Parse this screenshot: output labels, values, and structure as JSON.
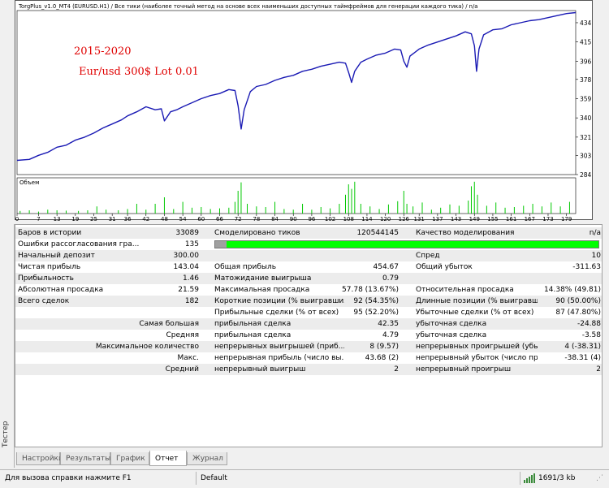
{
  "chart": {
    "header": "TorgPlus_v1.0_MT4 (EURUSD.H1) / Все тики (наиболее точный метод на основе всех наименьших доступных таймфреймов для генерации каждого тика) / n/a",
    "annotation_line1": "2015-2020",
    "annotation_line2": "Eur/usd 300$ Lot 0.01",
    "volume_label": "Объем",
    "line_color": "#1a1ab4",
    "volume_color": "#00c800",
    "annotation_color": "#e00000"
  },
  "chart_data": {
    "type": "line",
    "title": "",
    "ylim": [
      284,
      446
    ],
    "y_ticks": [
      "434",
      "415",
      "396",
      "378",
      "359",
      "340",
      "321",
      "303",
      "284"
    ],
    "x_ticks": [
      "0",
      "7",
      "13",
      "19",
      "25",
      "31",
      "36",
      "42",
      "48",
      "54",
      "60",
      "66",
      "72",
      "78",
      "84",
      "90",
      "96",
      "102",
      "108",
      "114",
      "120",
      "126",
      "131",
      "137",
      "143",
      "149",
      "155",
      "161",
      "167",
      "173",
      "179"
    ],
    "series": [
      {
        "values": [
          [
            0,
            298
          ],
          [
            4,
            299
          ],
          [
            7,
            303
          ],
          [
            10,
            306
          ],
          [
            13,
            311
          ],
          [
            16,
            313
          ],
          [
            19,
            318
          ],
          [
            22,
            321
          ],
          [
            25,
            325
          ],
          [
            28,
            330
          ],
          [
            31,
            334
          ],
          [
            34,
            338
          ],
          [
            36,
            342
          ],
          [
            39,
            346
          ],
          [
            42,
            351
          ],
          [
            45,
            348
          ],
          [
            47,
            349
          ],
          [
            48,
            337
          ],
          [
            50,
            346
          ],
          [
            52,
            348
          ],
          [
            54,
            351
          ],
          [
            57,
            355
          ],
          [
            60,
            359
          ],
          [
            63,
            362
          ],
          [
            66,
            364
          ],
          [
            69,
            368
          ],
          [
            71,
            367
          ],
          [
            72,
            352
          ],
          [
            73,
            329
          ],
          [
            74,
            348
          ],
          [
            76,
            366
          ],
          [
            78,
            371
          ],
          [
            81,
            373
          ],
          [
            84,
            377
          ],
          [
            87,
            380
          ],
          [
            90,
            382
          ],
          [
            93,
            386
          ],
          [
            96,
            388
          ],
          [
            99,
            391
          ],
          [
            102,
            393
          ],
          [
            105,
            395
          ],
          [
            107,
            394
          ],
          [
            108,
            385
          ],
          [
            109,
            375
          ],
          [
            110,
            386
          ],
          [
            112,
            395
          ],
          [
            114,
            398
          ],
          [
            117,
            402
          ],
          [
            120,
            404
          ],
          [
            123,
            408
          ],
          [
            125,
            407
          ],
          [
            126,
            396
          ],
          [
            127,
            390
          ],
          [
            128,
            401
          ],
          [
            131,
            408
          ],
          [
            134,
            412
          ],
          [
            137,
            415
          ],
          [
            140,
            418
          ],
          [
            143,
            421
          ],
          [
            146,
            425
          ],
          [
            148,
            423
          ],
          [
            149,
            411
          ],
          [
            149.7,
            386
          ],
          [
            150.5,
            408
          ],
          [
            152,
            422
          ],
          [
            155,
            427
          ],
          [
            158,
            428
          ],
          [
            161,
            432
          ],
          [
            164,
            434
          ],
          [
            167,
            436
          ],
          [
            170,
            437
          ],
          [
            173,
            439
          ],
          [
            176,
            441
          ],
          [
            179,
            443
          ],
          [
            182,
            444
          ]
        ]
      }
    ],
    "volume_spikes": [
      [
        1,
        0.08
      ],
      [
        4,
        0.1
      ],
      [
        7,
        0.06
      ],
      [
        10,
        0.12
      ],
      [
        13,
        0.1
      ],
      [
        16,
        0.09
      ],
      [
        20,
        0.08
      ],
      [
        23,
        0.1
      ],
      [
        26,
        0.22
      ],
      [
        29,
        0.12
      ],
      [
        33,
        0.1
      ],
      [
        36,
        0.14
      ],
      [
        39,
        0.3
      ],
      [
        42,
        0.12
      ],
      [
        45,
        0.3
      ],
      [
        48,
        0.5
      ],
      [
        51,
        0.14
      ],
      [
        54,
        0.36
      ],
      [
        57,
        0.18
      ],
      [
        60,
        0.2
      ],
      [
        63,
        0.14
      ],
      [
        66,
        0.16
      ],
      [
        69,
        0.18
      ],
      [
        71,
        0.36
      ],
      [
        72,
        0.7
      ],
      [
        73,
        0.96
      ],
      [
        75,
        0.3
      ],
      [
        78,
        0.22
      ],
      [
        81,
        0.2
      ],
      [
        84,
        0.36
      ],
      [
        87,
        0.14
      ],
      [
        90,
        0.12
      ],
      [
        93,
        0.3
      ],
      [
        96,
        0.12
      ],
      [
        99,
        0.2
      ],
      [
        102,
        0.16
      ],
      [
        105,
        0.3
      ],
      [
        107,
        0.58
      ],
      [
        108,
        0.9
      ],
      [
        109,
        0.76
      ],
      [
        110,
        0.98
      ],
      [
        112,
        0.3
      ],
      [
        115,
        0.22
      ],
      [
        118,
        0.14
      ],
      [
        121,
        0.28
      ],
      [
        124,
        0.38
      ],
      [
        126,
        0.7
      ],
      [
        127,
        0.3
      ],
      [
        129,
        0.22
      ],
      [
        132,
        0.34
      ],
      [
        135,
        0.12
      ],
      [
        138,
        0.18
      ],
      [
        141,
        0.28
      ],
      [
        144,
        0.24
      ],
      [
        147,
        0.4
      ],
      [
        148,
        0.84
      ],
      [
        149,
        0.98
      ],
      [
        150,
        0.58
      ],
      [
        153,
        0.24
      ],
      [
        156,
        0.34
      ],
      [
        159,
        0.18
      ],
      [
        162,
        0.2
      ],
      [
        165,
        0.24
      ],
      [
        168,
        0.3
      ],
      [
        171,
        0.22
      ],
      [
        174,
        0.34
      ],
      [
        177,
        0.22
      ],
      [
        180,
        0.36
      ]
    ]
  },
  "report": {
    "rows": [
      {
        "a_label": "Баров в истории",
        "a_val": "33089",
        "b_label": "Смоделировано тиков",
        "b_val": "120544145",
        "c_label": "Качество моделирования",
        "c_val": "n/a"
      },
      {
        "a_label": "Ошибки рассогласования гра...",
        "a_val": "135",
        "quality_bar_color": "#00ff00"
      },
      {
        "a_label": "Начальный депозит",
        "a_val": "300.00",
        "c_label": "Спред",
        "c_val": "10"
      },
      {
        "a_label": "Чистая прибыль",
        "a_val": "143.04",
        "b_label": "Общая прибыль",
        "b_val": "454.67",
        "c_label": "Общий убыток",
        "c_val": "-311.63"
      },
      {
        "a_label": "Прибыльность",
        "a_val": "1.46",
        "b_label": "Матожидание выигрыша",
        "b_val": "0.79"
      },
      {
        "a_label": "Абсолютная просадка",
        "a_val": "21.59",
        "b_label": "Максимальная просадка",
        "b_val": "57.78 (13.67%)",
        "c_label": "Относительная просадка",
        "c_val": "14.38% (49.81)"
      },
      {
        "a_label": "Всего сделок",
        "a_val": "182",
        "b_label": "Короткие позиции (% выигравших)",
        "b_val": "92 (54.35%)",
        "c_label": "Длинные позиции (% выигравших)",
        "c_val": "90 (50.00%)"
      },
      {
        "b_label": "Прибыльные сделки (% от всех)",
        "b_val": "95 (52.20%)",
        "c_label": "Убыточные сделки (% от всех)",
        "c_val": "87 (47.80%)"
      },
      {
        "a_label": "Самая большая",
        "b_label": "прибыльная сделка",
        "b_val": "42.35",
        "c_label": "убыточная сделка",
        "c_val": "-24.88"
      },
      {
        "a_label": "Средняя",
        "b_label": "прибыльная сделка",
        "b_val": "4.79",
        "c_label": "убыточная сделка",
        "c_val": "-3.58"
      },
      {
        "a_label": "Максимальное количество",
        "b_label": "непрерывных выигрышей (приб...",
        "b_val": "8 (9.57)",
        "c_label": "непрерывных проигрышей (убыт...",
        "c_val": "4 (-38.31)"
      },
      {
        "a_label": "Макс.",
        "b_label": "непрерывная прибыль (число вы...",
        "b_val": "43.68 (2)",
        "c_label": "непрерывный убыток (число про...",
        "c_val": "-38.31 (4)"
      },
      {
        "a_label": "Средний",
        "b_label": "непрерывный выигрыш",
        "b_val": "2",
        "c_label": "непрерывный проигрыш",
        "c_val": "2"
      }
    ]
  },
  "side": {
    "tester_label": "Тестер"
  },
  "tabs": [
    {
      "label": "Настройки",
      "active": false
    },
    {
      "label": "Результаты",
      "active": false
    },
    {
      "label": "График",
      "active": false
    },
    {
      "label": "Отчет",
      "active": true
    },
    {
      "label": "Журнал",
      "active": false
    }
  ],
  "status": {
    "help_text": "Для вызова справки нажмите F1",
    "profile": "Default",
    "traffic": "1691/3 kb"
  }
}
